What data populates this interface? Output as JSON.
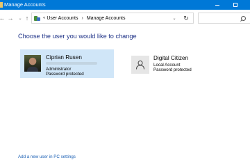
{
  "window": {
    "title": "Manage Accounts",
    "icon": "user-accounts-app-icon",
    "accent_color": "#0078d7"
  },
  "nav": {
    "back_glyph": "←",
    "forward_glyph": "→",
    "recent_glyph": "⌄",
    "up_glyph": "↑",
    "refresh_glyph": "↻",
    "dropdown_glyph": "⌄"
  },
  "address": {
    "separator_start": "«",
    "breadcrumbs": [
      "User Accounts",
      "Manage Accounts"
    ],
    "separator": "›"
  },
  "main": {
    "heading": "Choose the user you would like to change",
    "heading_color": "#1e3287",
    "selected_card_color": "#d0e6f8",
    "accounts": [
      {
        "name": "Ciprian Rusen",
        "role": "Administrator",
        "status": "Password protected",
        "avatar": "photo-avatar"
      },
      {
        "name": "Digital Citizen",
        "role": "Local Account",
        "status": "Password protected",
        "avatar": "generic-user-icon"
      }
    ],
    "add_user_link": "Add a new user in PC settings"
  }
}
